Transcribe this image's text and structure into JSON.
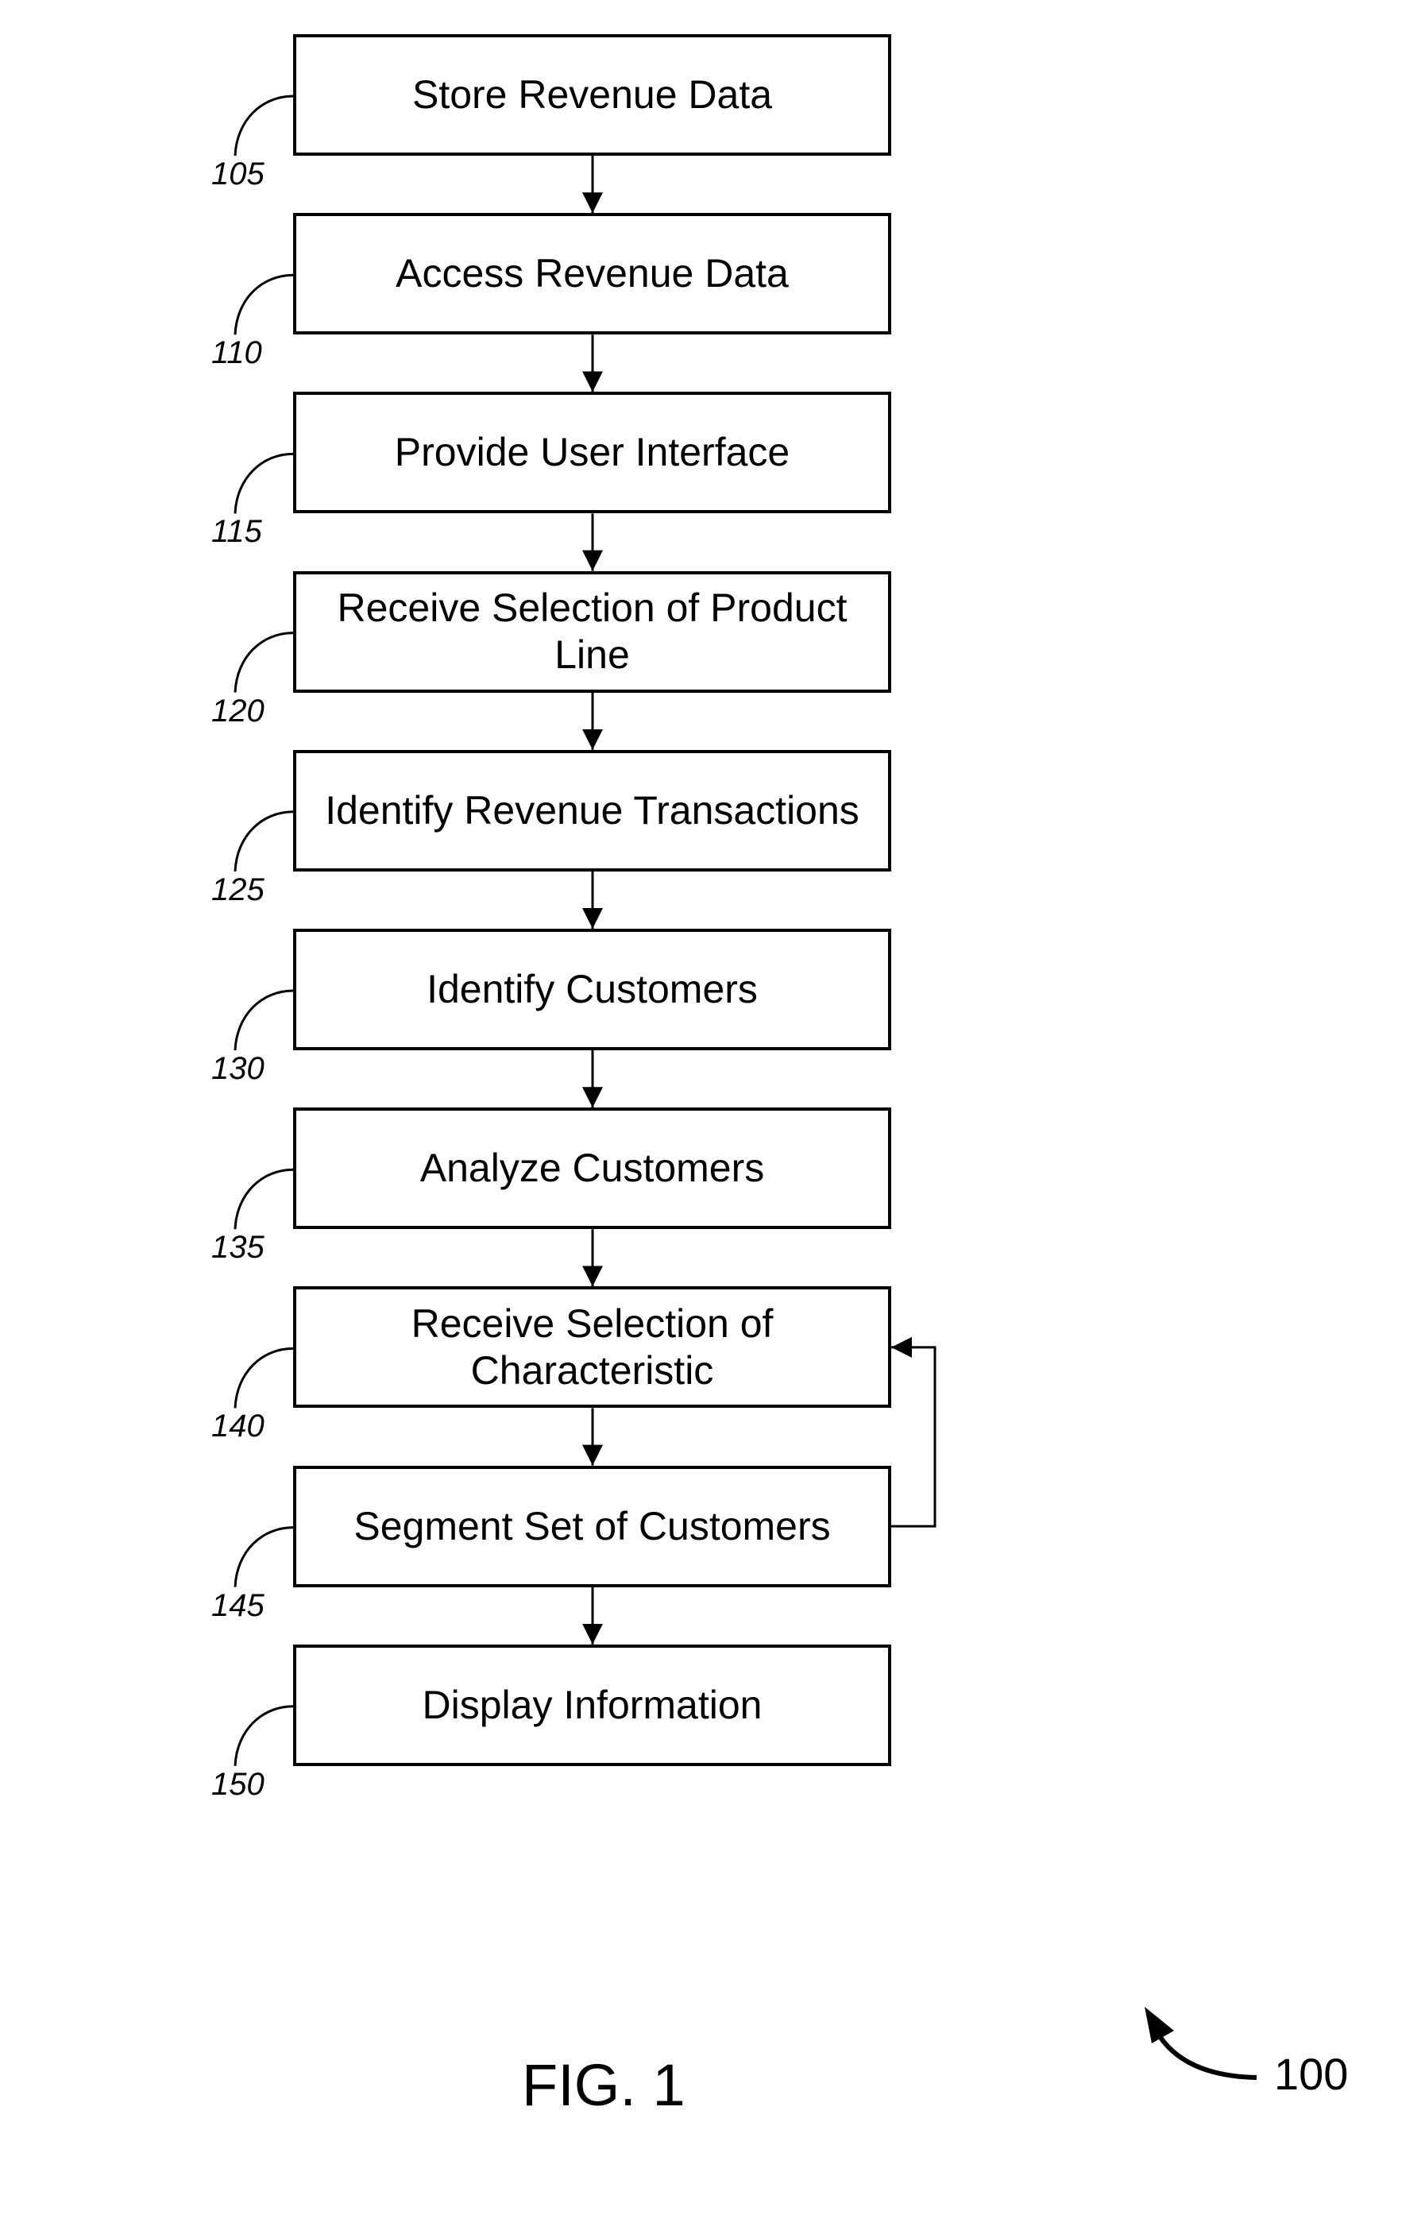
{
  "figure": {
    "title": "FIG. 1",
    "reference_number": "100"
  },
  "steps": [
    {
      "ref": "105",
      "label": "Store Revenue Data"
    },
    {
      "ref": "110",
      "label": "Access Revenue Data"
    },
    {
      "ref": "115",
      "label": "Provide User Interface"
    },
    {
      "ref": "120",
      "label": "Receive Selection of Product\nLine"
    },
    {
      "ref": "125",
      "label": "Identify Revenue Transactions"
    },
    {
      "ref": "130",
      "label": "Identify Customers"
    },
    {
      "ref": "135",
      "label": "Analyze Customers"
    },
    {
      "ref": "140",
      "label": "Receive Selection of\nCharacteristic"
    },
    {
      "ref": "145",
      "label": "Segment Set of Customers"
    },
    {
      "ref": "150",
      "label": "Display Information"
    }
  ],
  "edges": [
    {
      "from": "105",
      "to": "110",
      "type": "sequential"
    },
    {
      "from": "110",
      "to": "115",
      "type": "sequential"
    },
    {
      "from": "115",
      "to": "120",
      "type": "sequential"
    },
    {
      "from": "120",
      "to": "125",
      "type": "sequential"
    },
    {
      "from": "125",
      "to": "130",
      "type": "sequential"
    },
    {
      "from": "130",
      "to": "135",
      "type": "sequential"
    },
    {
      "from": "135",
      "to": "140",
      "type": "sequential"
    },
    {
      "from": "140",
      "to": "145",
      "type": "sequential"
    },
    {
      "from": "145",
      "to": "150",
      "type": "sequential"
    },
    {
      "from": "145",
      "to": "140",
      "type": "feedback"
    }
  ],
  "colors": {
    "stroke": "#000000",
    "background": "#ffffff"
  }
}
